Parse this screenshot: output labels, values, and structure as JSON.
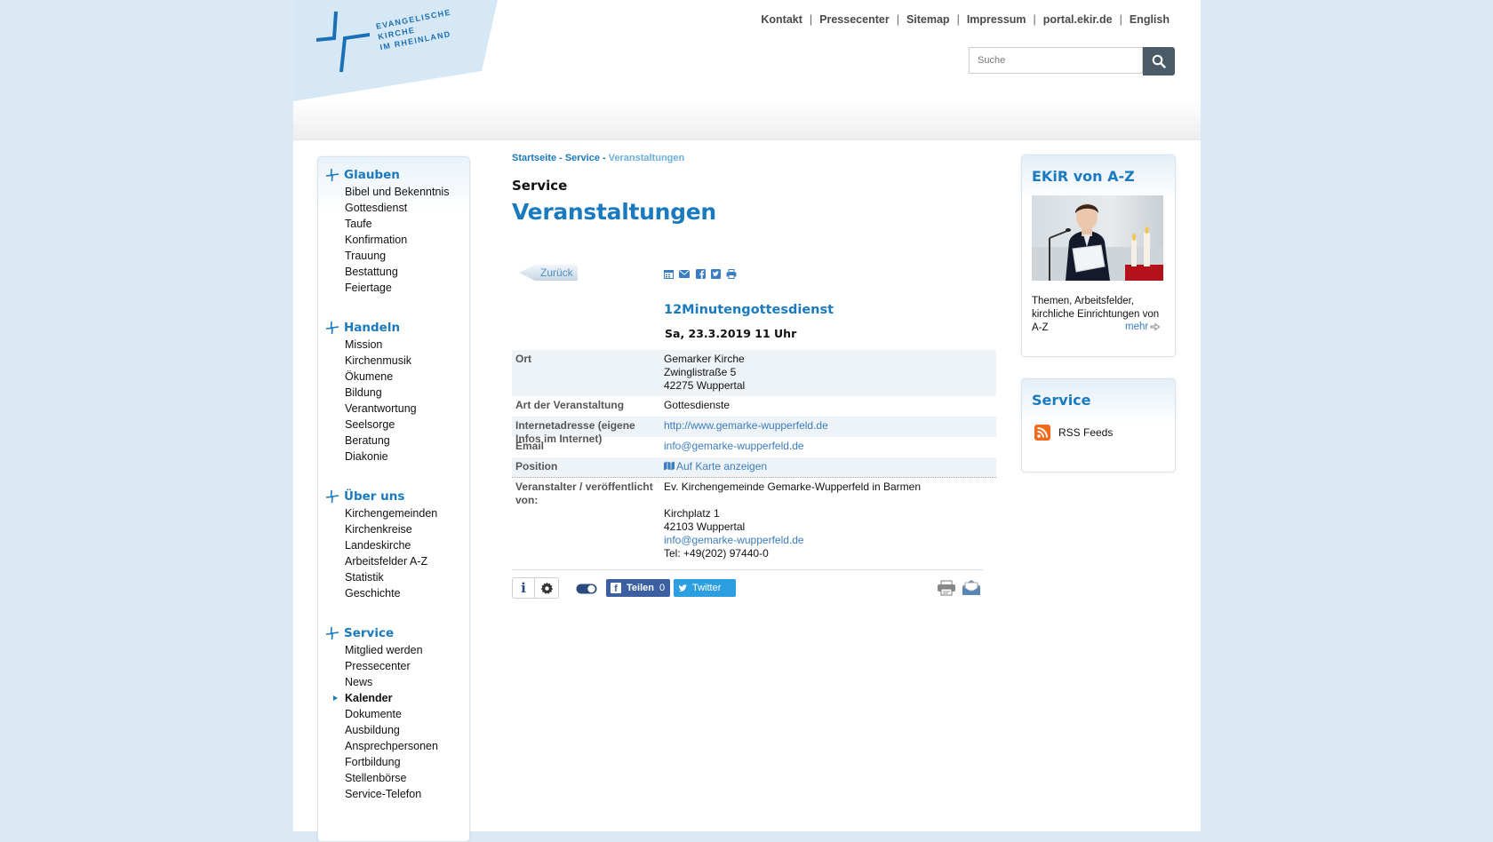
{
  "logo": {
    "line1": "EVANGELISCHE",
    "line2": "KIRCHE",
    "line3": "IM RHEINLAND"
  },
  "meta_nav": [
    {
      "label": "Kontakt"
    },
    {
      "label": "Pressecenter"
    },
    {
      "label": "Sitemap"
    },
    {
      "label": "Impressum"
    },
    {
      "label": "portal.ekir.de"
    },
    {
      "label": "English"
    }
  ],
  "meta_nav_separator": "|",
  "search": {
    "placeholder": "Suche"
  },
  "leftnav": [
    {
      "title": "Glauben",
      "items": [
        "Bibel und Bekenntnis",
        "Gottesdienst",
        "Taufe",
        "Konfirmation",
        "Trauung",
        "Bestattung",
        "Feiertage"
      ]
    },
    {
      "title": "Handeln",
      "items": [
        "Mission",
        "Kirchenmusik",
        "Ökumene",
        "Bildung",
        "Verantwortung",
        "Seelsorge",
        "Beratung",
        "Diakonie"
      ]
    },
    {
      "title": "Über uns",
      "items": [
        "Kirchengemeinden",
        "Kirchenkreise",
        "Landeskirche",
        "Arbeitsfelder A-Z",
        "Statistik",
        "Geschichte"
      ]
    },
    {
      "title": "Service",
      "items": [
        "Mitglied werden",
        "Pressecenter",
        "News",
        "Kalender",
        "Dokumente",
        "Ausbildung",
        "Ansprechpersonen",
        "Fortbildung",
        "Stellenbörse",
        "Service-Telefon"
      ]
    }
  ],
  "leftnav_active": "Kalender",
  "breadcrumb": {
    "home": "Startseite",
    "sep": "-",
    "level2": "Service",
    "current": "Veranstaltungen"
  },
  "section_title": "Service",
  "page_title": "Veranstaltungen",
  "back_label": "Zurück",
  "event": {
    "title": "12Minutengottesdienst",
    "date": "Sa, 23.3.2019 11 Uhr",
    "rows": {
      "ort": {
        "label": "Ort",
        "lines": [
          "Gemarker Kirche",
          "Zwinglistraße 5",
          "42275 Wuppertal"
        ]
      },
      "art": {
        "label": "Art der Veranstaltung",
        "value": "Gottesdienste"
      },
      "url": {
        "label": "Internetadresse (eigene Infos im Internet)",
        "value": "http://www.gemarke-wupperfeld.de"
      },
      "email": {
        "label": "Email",
        "value": "info@gemarke-wupperfeld.de"
      },
      "position": {
        "label": "Position",
        "value": "Auf Karte anzeigen"
      },
      "veranstalter": {
        "label": "Veranstalter / veröffentlicht von:",
        "name": "Ev. Kirchengemeinde Gemarke-Wupperfeld in Barmen",
        "street": "Kirchplatz 1",
        "city": "42103 Wuppertal",
        "email": "info@gemarke-wupperfeld.de",
        "tel": "Tel: +49(202) 97440-0"
      }
    }
  },
  "social": {
    "info_label": "i",
    "fb_logo": "f",
    "fb_label": "Teilen",
    "fb_count": "0",
    "tw_label": "Twitter"
  },
  "right": {
    "az_title": "EKiR von A-Z",
    "az_text": "Themen, Arbeitsfelder, kirchliche Einrichtungen von A-Z",
    "az_more": "mehr",
    "service_title": "Service",
    "rss_label": "RSS Feeds"
  },
  "colors": {
    "accent": "#1a7ac0",
    "link": "#3a7dc0",
    "page_bg": "#dbe9f4",
    "facebook": "#3b5fa0",
    "twitter": "#2d9fe0",
    "rss": "#f26b1d"
  }
}
